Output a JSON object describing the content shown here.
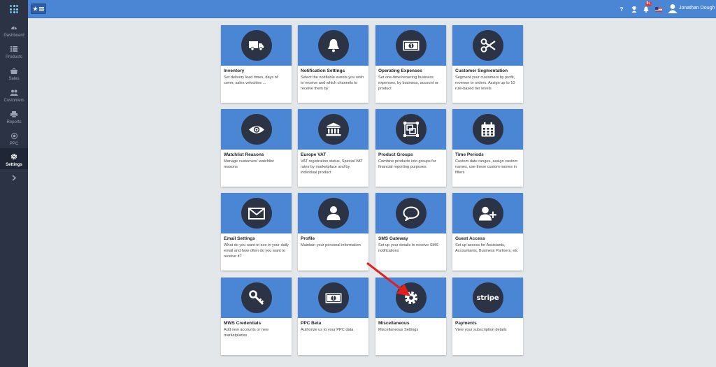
{
  "sidebar": {
    "items": [
      {
        "label": "Dashboard",
        "icon": "speedometer-icon"
      },
      {
        "label": "Products",
        "icon": "list-icon"
      },
      {
        "label": "Sales",
        "icon": "basket-icon"
      },
      {
        "label": "Customers",
        "icon": "users-icon"
      },
      {
        "label": "Reports",
        "icon": "printer-icon"
      },
      {
        "label": "PPC",
        "icon": "target-icon"
      },
      {
        "label": "Settings",
        "icon": "gear-icon"
      }
    ]
  },
  "header": {
    "user_name": "Jonathan Dough",
    "notification_badge": "9+",
    "help_label": "?"
  },
  "cards": [
    {
      "title": "Inventory",
      "desc": "Set delivery lead times, days of cover, sales velocities ...",
      "icon": "truck-icon"
    },
    {
      "title": "Notification Settings",
      "desc": "Select the notifiable events you wish to receive and which channels to receive them by",
      "icon": "bell-icon"
    },
    {
      "title": "Operating Expenses",
      "desc": "Set one-time/recurring business expenses, by business, account or product",
      "icon": "banknote-icon"
    },
    {
      "title": "Customer Segmentation",
      "desc": "Segment your customers by profit, revenue or orders. Assign up to 10 rule-based tier levels",
      "icon": "scissors-icon"
    },
    {
      "title": "Watchlist Reasons",
      "desc": "Manage customers' watchlist reasons",
      "icon": "eye-icon"
    },
    {
      "title": "Europe VAT",
      "desc": "VAT registration status, Special VAT rates by marketplace and by individual product",
      "icon": "bank-icon"
    },
    {
      "title": "Product Groups",
      "desc": "Combine products into groups for financial reporting purposes",
      "icon": "object-group-icon"
    },
    {
      "title": "Time Periods",
      "desc": "Custom date ranges, assign custom names, use these custom names in filters",
      "icon": "calendar-icon"
    },
    {
      "title": "Email Settings",
      "desc": "What do you want to see in your daily email and how often do you want to receive it?",
      "icon": "envelope-icon"
    },
    {
      "title": "Profile",
      "desc": "Maintain your personal information",
      "icon": "user-icon"
    },
    {
      "title": "SMS Gateway",
      "desc": "Set up your details to receive SMS notifications",
      "icon": "speech-bubble-icon"
    },
    {
      "title": "Guest Access",
      "desc": "Set up access for Assistants, Accountants, Business Partners, etc",
      "icon": "user-plus-icon"
    },
    {
      "title": "MWS Credentials",
      "desc": "Add new accounts or new marketplaces",
      "icon": "key-icon"
    },
    {
      "title": "PPC Beta",
      "desc": "Authorize us to your PPC data",
      "icon": "banknote-icon"
    },
    {
      "title": "Miscellaneous",
      "desc": "Miscellaneous Settings",
      "icon": "gear-icon"
    },
    {
      "title": "Payments",
      "desc": "View your subscription details",
      "icon": "stripe-logo-icon",
      "logo_text": "stripe"
    }
  ],
  "colors": {
    "sidebar": "#2b3345",
    "topbar": "#4a86d4",
    "card_header": "#4a86d4",
    "icon_circle": "#2b3345",
    "arrow": "#e31e1e"
  }
}
